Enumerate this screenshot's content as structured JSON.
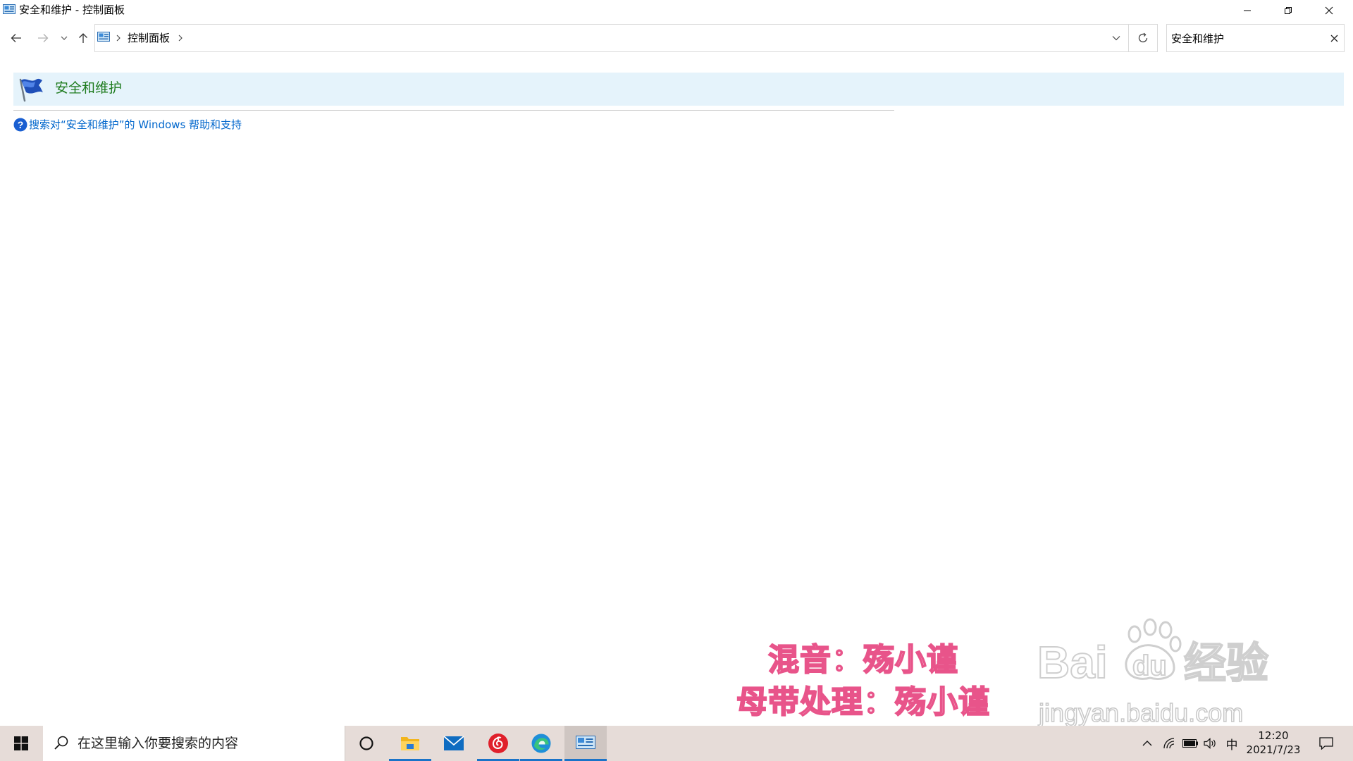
{
  "window": {
    "title": "安全和维护 - 控制面板",
    "icons": {
      "app": "control-panel-icon",
      "minimize": "minimize-icon",
      "maximize": "restore-icon",
      "close": "close-icon"
    }
  },
  "navigation": {
    "back_icon": "arrow-left-icon",
    "forward_icon": "arrow-right-icon",
    "recent_icon": "chevron-down-icon",
    "up_icon": "arrow-up-icon",
    "breadcrumb": [
      "控制面板"
    ],
    "refresh_icon": "refresh-icon"
  },
  "search": {
    "value": "安全和维护",
    "clear_icon": "close-icon"
  },
  "results": [
    {
      "title": "安全和维护",
      "icon": "flag-icon",
      "selected": true
    }
  ],
  "help_link": {
    "text": "搜索对“安全和维护”的 Windows 帮助和支持",
    "icon": "help-icon"
  },
  "watermark": {
    "line1": "混音：殇小谨",
    "line2": "母带处理：殇小谨",
    "brand_logo_text": "Baidu经验",
    "brand_url": "jingyan.baidu.com"
  },
  "taskbar": {
    "search_placeholder": "在这里输入你要搜索的内容",
    "apps": [
      "cortana-icon",
      "file-explorer-icon",
      "mail-icon",
      "netease-music-icon",
      "edge-icon",
      "control-panel-icon"
    ],
    "active_app": "control-panel-icon",
    "tray": {
      "ime": "中",
      "time": "12:20",
      "date": "2021/7/23"
    }
  },
  "colors": {
    "accent": "#1a73c8",
    "result_highlight": "#e5f3fb",
    "result_title": "#1e7b1e",
    "link": "#0066cc",
    "taskbar": "#e6dcd8",
    "watermark_pink": "#e8548a"
  }
}
